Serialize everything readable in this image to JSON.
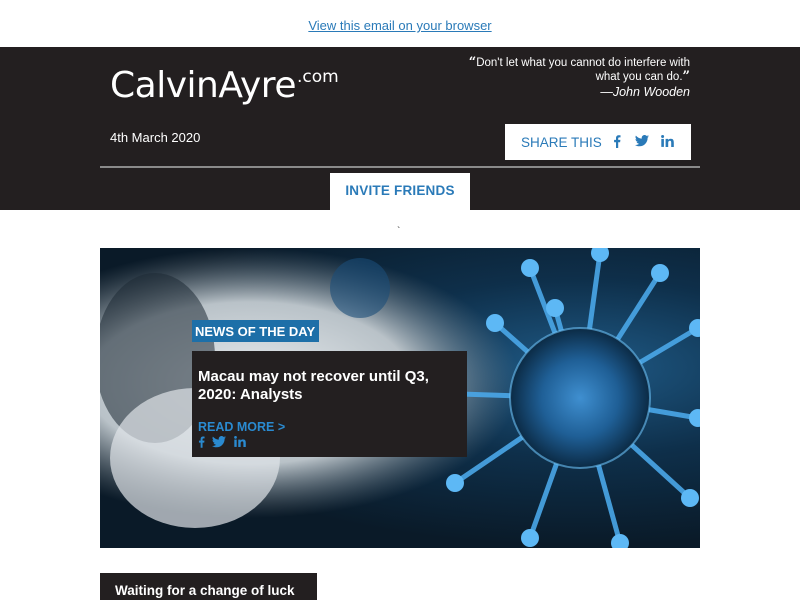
{
  "top": {
    "view_in_browser": "View this email on your browser"
  },
  "header": {
    "logo_main": "CalvinAyre",
    "logo_suffix": ".com",
    "quote_open": "“",
    "quote_text": "Don't let what you cannot do interfere with what you can do.",
    "quote_close": "”",
    "quote_author": "—John Wooden",
    "date": "4th March 2020",
    "share_label": "SHARE THIS",
    "share_icons": [
      "facebook-icon",
      "twitter-icon",
      "linkedin-icon"
    ],
    "invite_label": "INVITE FRIENDS"
  },
  "separator_glyph": "`",
  "featured": {
    "badge": "NEWS OF THE DAY",
    "title": "Macau may not recover until Q3, 2020: Analysts",
    "read_more": "READ MORE >",
    "social_icons": [
      "facebook-icon",
      "twitter-icon",
      "linkedin-icon"
    ]
  },
  "next_section": {
    "title": "Waiting for a change of luck"
  },
  "colors": {
    "header_bg": "#231f20",
    "accent_blue": "#2a7ab8",
    "badge_blue": "#1d6fa8"
  }
}
